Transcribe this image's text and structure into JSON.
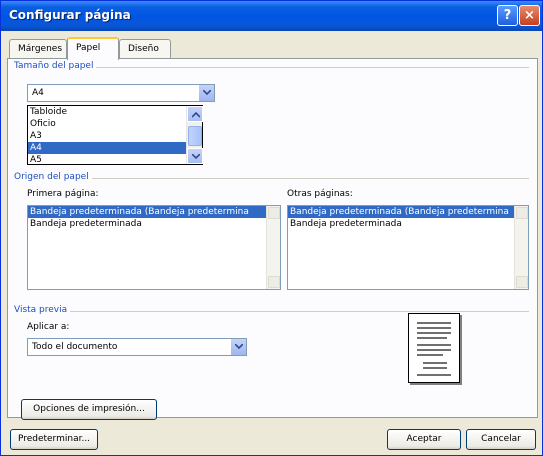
{
  "window": {
    "title": "Configurar página"
  },
  "titlebar": {
    "help_label": "?",
    "close_label": "×"
  },
  "tabs": [
    {
      "label": "Márgenes",
      "active": false
    },
    {
      "label": "Papel",
      "active": true
    },
    {
      "label": "Diseño",
      "active": false
    }
  ],
  "paper_size": {
    "group_label": "Tamaño del papel",
    "selected": "A4",
    "options": [
      "Tabloide",
      "Oficio",
      "A3",
      "A4",
      "A5"
    ]
  },
  "paper_source": {
    "group_label": "Origen del papel",
    "first_page": {
      "label": "Primera página:",
      "items": [
        "Bandeja predeterminada (Bandeja predetermina",
        "Bandeja predeterminada"
      ]
    },
    "other_pages": {
      "label": "Otras páginas:",
      "items": [
        "Bandeja predeterminada (Bandeja predetermina",
        "Bandeja predeterminada"
      ]
    }
  },
  "preview": {
    "group_label": "Vista previa",
    "apply_label": "Aplicar a:",
    "apply_value": "Todo el documento"
  },
  "buttons": {
    "print_options": "Opciones de impresión...",
    "default": "Predeterminar...",
    "ok": "Aceptar",
    "cancel": "Cancelar"
  },
  "colors": {
    "titlebar": "#0055e5",
    "selection": "#316ac5",
    "group_label": "#1d4fbf",
    "dialog_bg": "#ece9d8"
  }
}
